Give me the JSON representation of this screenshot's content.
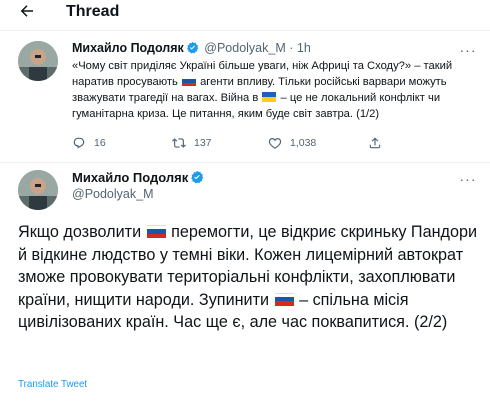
{
  "header": {
    "title": "Thread",
    "back_icon": "arrow-left-icon"
  },
  "tweet1": {
    "author_name": "Михайло Подоляк",
    "handle": "@Podolyak_M",
    "separator": "·",
    "time": "1h",
    "more_label": "···",
    "text_part1": "«Чому світ приділяє Україні більше уваги, ніж Африці та Сходу?» – такий наратив просувають",
    "text_part2": "агенти впливу. Тільки російські варвари можуть зважувати трагедії на вагах. Війна в",
    "text_part3": "– це не локальний конфлікт чи гуманітарна криза. Це питання, яким буде світ завтра. (1/2)",
    "flag_a": "russia-flag",
    "flag_b": "ukraine-flag",
    "replies": "16",
    "retweets": "137",
    "likes": "1,038"
  },
  "tweet2": {
    "author_name": "Михайло Подоляк",
    "handle": "@Podolyak_M",
    "text_part1": "Якщо дозволити",
    "text_part2": "перемогти, це відкриє скриньку Пандори й відкине людство у темні віки. Кожен лицемірний автократ зможе провокувати територіальні конфлікти, захоплювати країни, нищити народи. Зупинити",
    "text_part3": "– спільна місія цивілізованих країн. Час ще є, але час поквапитися. (2/2)",
    "translate_label": "Translate Tweet"
  },
  "colors": {
    "link_blue": "#1d9bf0",
    "secondary_text": "#536471",
    "verified_blue": "#1d9bf0",
    "divider": "#eff3f4"
  }
}
